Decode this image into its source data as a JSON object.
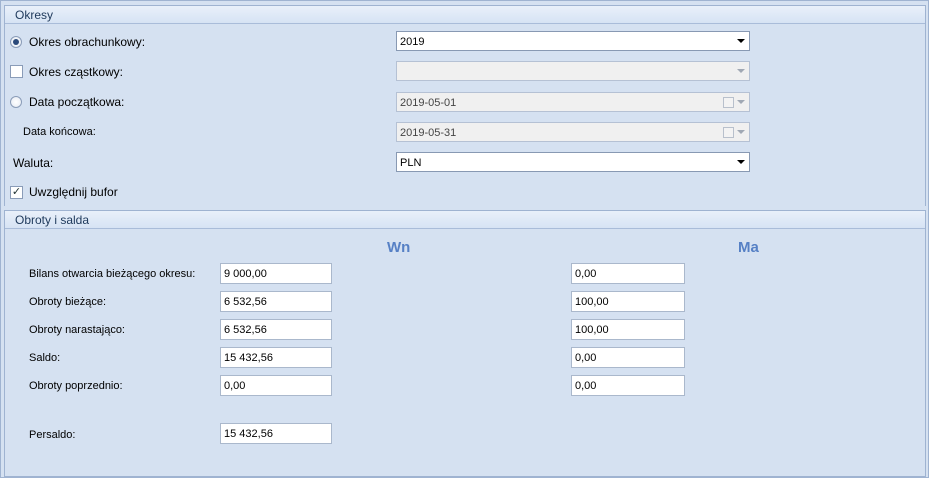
{
  "okresy": {
    "title": "Okresy",
    "okres_obrachunkowy": {
      "label": "Okres obrachunkowy:",
      "value": "2019",
      "selected": true
    },
    "okres_czastkowy": {
      "label": "Okres cząstkowy:",
      "value": "",
      "checked": false
    },
    "data_poczatkowa": {
      "label": "Data początkowa:",
      "value": "2019-05-01",
      "selected": false
    },
    "data_koncowa": {
      "label": "Data końcowa:",
      "value": "2019-05-31"
    },
    "waluta": {
      "label": "Waluta:",
      "value": "PLN"
    },
    "uwzglednij_bufor": {
      "label": "Uwzględnij bufor",
      "checked": true
    }
  },
  "obroty": {
    "title": "Obroty i salda",
    "col_wn": "Wn",
    "col_ma": "Ma",
    "rows": [
      {
        "label": "Bilans otwarcia bieżącego okresu:",
        "wn": "9 000,00",
        "ma": "0,00"
      },
      {
        "label": "Obroty bieżące:",
        "wn": "6 532,56",
        "ma": "100,00"
      },
      {
        "label": "Obroty narastająco:",
        "wn": "6 532,56",
        "ma": "100,00"
      },
      {
        "label": "Saldo:",
        "wn": "15 432,56",
        "ma": "0,00"
      },
      {
        "label": "Obroty poprzednio:",
        "wn": "0,00",
        "ma": "0,00"
      }
    ],
    "persaldo": {
      "label": "Persaldo:",
      "wn": "15 432,56"
    }
  },
  "icons": {
    "checkmark": "checkmark-icon",
    "dropdown": "chevron-down-icon",
    "calendar": "calendar-icon"
  }
}
